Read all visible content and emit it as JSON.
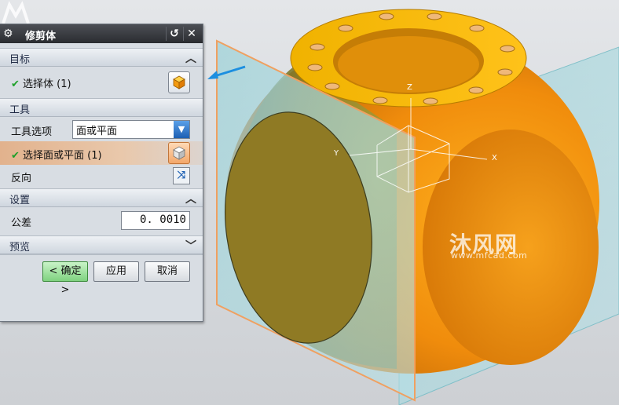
{
  "dialog": {
    "title": "修剪体",
    "title_buttons": {
      "reset_icon": "reset-icon",
      "close_icon": "close-icon"
    },
    "target": {
      "header": "目标",
      "select_body_label": "选择体 (1)"
    },
    "tool": {
      "header": "工具",
      "tool_option_label": "工具选项",
      "tool_option_value": "面或平面",
      "select_face_label": "选择面或平面 (1)",
      "reverse_label": "反向"
    },
    "settings": {
      "header": "设置",
      "tolerance_label": "公差",
      "tolerance_value": "0. 0010"
    },
    "preview": {
      "header": "预览"
    },
    "buttons": {
      "ok": "< 确定 >",
      "apply": "应用",
      "cancel": "取消"
    }
  },
  "viewport": {
    "axis_z": "Z",
    "axis_y": "Y",
    "axis_x": "X",
    "watermark_cn": "沐风网",
    "watermark_url": "www.mfcad.com"
  },
  "colors": {
    "part_orange": "#f29a10",
    "plane_fill": "#a9d8df",
    "plane_edge": "#f0a060",
    "check": "#1fa12a",
    "accent_blue": "#1c5fb3"
  }
}
